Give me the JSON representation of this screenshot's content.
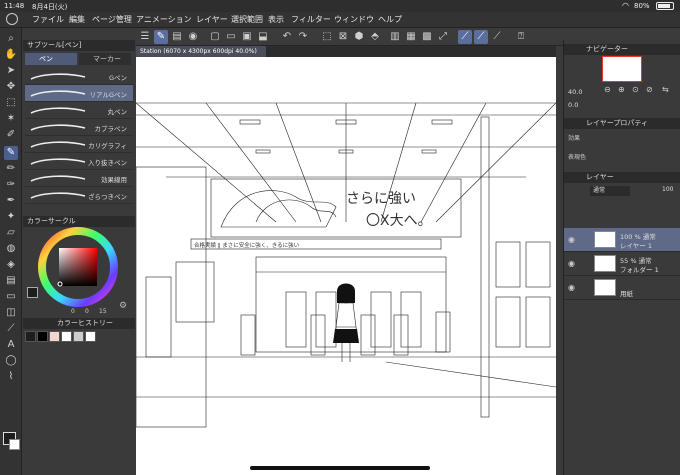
{
  "status": {
    "time": "11:48",
    "date": "8月4日(火)",
    "wifi_icon": "wifi-icon",
    "battery": "80%",
    "battery_icon": "battery-icon"
  },
  "menu": {
    "logo": "クリスタ",
    "items": [
      "ファイル",
      "編集",
      "ページ管理",
      "アニメーション",
      "レイヤー",
      "選択範囲",
      "表示",
      "フィルター",
      "ウィンドウ",
      "ヘルプ"
    ]
  },
  "subtool": {
    "header": "サブツール[ペン]",
    "tabs": [
      "ペン",
      "マーカー"
    ],
    "brushes": [
      "Gペン",
      "リアルGペン",
      "丸ペン",
      "カブラペン",
      "カリグラフィ",
      "入り抜きペン",
      "効果線用",
      "ざらつきペン"
    ],
    "selected_index": 1
  },
  "color_circle": {
    "header": "カラーサークル",
    "h": "0",
    "s": "0",
    "v": "15",
    "current_color": "#1e1e1e"
  },
  "color_history": {
    "header": "カラーヒストリー",
    "swatches": [
      "#1e1e1e",
      "#000000",
      "#f2d6cf",
      "#ffffff",
      "#cccccc",
      "#ffffff"
    ]
  },
  "canvas": {
    "tab": "Station (6070 x 4300px 600dpi 40.0%)",
    "sign_text_1": "さらに強い",
    "sign_text_2": "〇X大へ。",
    "banner_text": "合格実績 ‖ まさに安全に強く、きるに強い"
  },
  "navigator": {
    "header": "ナビゲーター",
    "zoom": "40.0",
    "rotation": "0.0"
  },
  "layer_property": {
    "header": "レイヤープロパティ",
    "effect_label": "効果",
    "color_label": "表現色"
  },
  "layers": {
    "header": "レイヤー",
    "blend_mode": "通常",
    "opacity": "100",
    "items": [
      {
        "line1": "100 % 通常",
        "line2": "レイヤー 1",
        "selected": true
      },
      {
        "line1": "55 % 通常",
        "line2": "フォルダー 1",
        "selected": false
      },
      {
        "line1": "",
        "line2": "用紙",
        "selected": false
      }
    ]
  },
  "colors": {
    "accent": "#5a6ea0",
    "panel": "#3a3a3a",
    "selected_row": "#5f6a88"
  }
}
